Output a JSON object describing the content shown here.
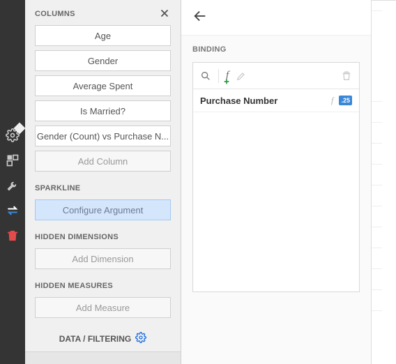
{
  "rail": {
    "items": [
      "gear-icon",
      "layout-icon",
      "wrench-icon",
      "swap-icon",
      "trash-icon"
    ]
  },
  "config": {
    "sections": {
      "columns": {
        "title": "COLUMNS",
        "items": [
          "Age",
          "Gender",
          "Average Spent",
          "Is Married?",
          "Gender (Count) vs Purchase N..."
        ],
        "addLabel": "Add Column"
      },
      "sparkline": {
        "title": "SPARKLINE",
        "button": "Configure Argument"
      },
      "hiddenDimensions": {
        "title": "HIDDEN DIMENSIONS",
        "addLabel": "Add Dimension"
      },
      "hiddenMeasures": {
        "title": "HIDDEN MEASURES",
        "addLabel": "Add Measure"
      }
    },
    "footerLink": "DATA / FILTERING"
  },
  "binding": {
    "title": "BINDING",
    "toolbar": {
      "icons": [
        "search-icon",
        "fx-add-icon",
        "edit-icon",
        "delete-icon"
      ]
    },
    "items": [
      {
        "label": "Purchase Number",
        "formatBadge": ".25"
      }
    ]
  }
}
